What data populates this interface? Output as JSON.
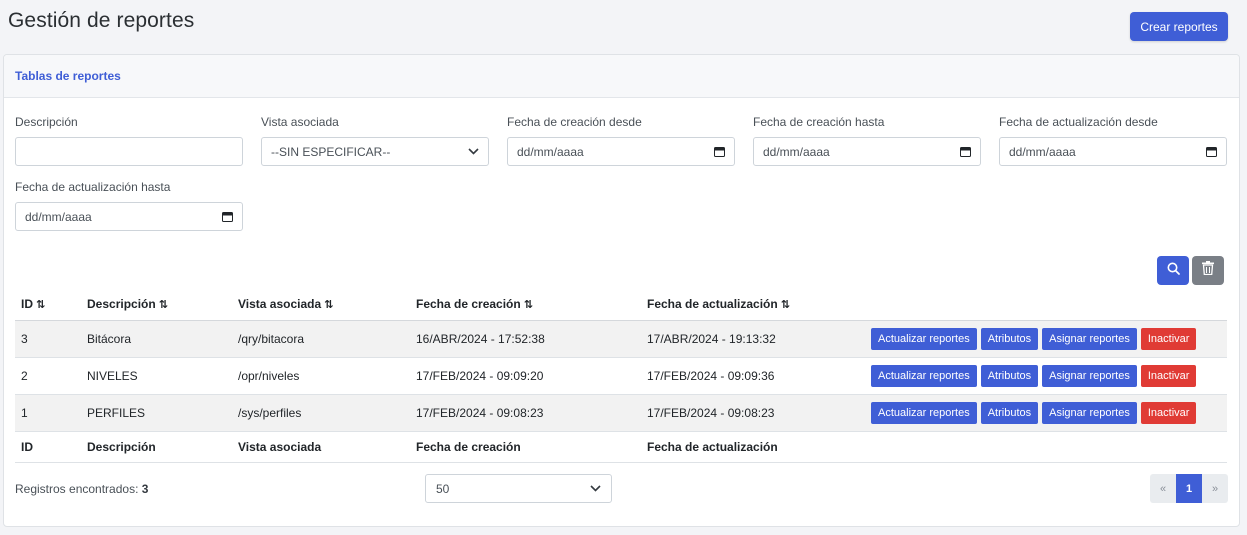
{
  "page": {
    "title": "Gestión de reportes",
    "create_button": "Crear reportes"
  },
  "card": {
    "title": "Tablas de reportes"
  },
  "filters": {
    "descripcion": {
      "label": "Descripción",
      "value": ""
    },
    "vista": {
      "label": "Vista asociada",
      "value": "--SIN ESPECIFICAR--"
    },
    "creacion_desde": {
      "label": "Fecha de creación desde",
      "placeholder": "dd/mm/aaaa"
    },
    "creacion_hasta": {
      "label": "Fecha de creación hasta",
      "placeholder": "dd/mm/aaaa"
    },
    "actualizacion_desde": {
      "label": "Fecha de actualización desde",
      "placeholder": "dd/mm/aaaa"
    },
    "actualizacion_hasta": {
      "label": "Fecha de actualización hasta",
      "placeholder": "dd/mm/aaaa"
    }
  },
  "table": {
    "columns": [
      "ID",
      "Descripción",
      "Vista asociada",
      "Fecha de creación",
      "Fecha de actualización"
    ],
    "sort_glyph": "⇅",
    "rows": [
      {
        "id": "3",
        "descripcion": "Bitácora",
        "vista": "/qry/bitacora",
        "creacion": "16/ABR/2024 - 17:52:38",
        "actualizacion": "17/ABR/2024 - 19:13:32"
      },
      {
        "id": "2",
        "descripcion": "NIVELES",
        "vista": "/opr/niveles",
        "creacion": "17/FEB/2024 - 09:09:20",
        "actualizacion": "17/FEB/2024 - 09:09:36"
      },
      {
        "id": "1",
        "descripcion": "PERFILES",
        "vista": "/sys/perfiles",
        "creacion": "17/FEB/2024 - 09:08:23",
        "actualizacion": "17/FEB/2024 - 09:08:23"
      }
    ],
    "actions": {
      "actualizar": "Actualizar reportes",
      "atributos": "Atributos",
      "asignar": "Asignar reportes",
      "inactivar": "Inactivar"
    }
  },
  "footer": {
    "records_label": "Registros encontrados:",
    "records_count": "3",
    "per_page": "50",
    "pager": {
      "prev": "«",
      "current": "1",
      "next": "»"
    }
  },
  "colors": {
    "primary": "#3f5ed6",
    "danger": "#e03b35",
    "secondary": "#7a7f86"
  }
}
